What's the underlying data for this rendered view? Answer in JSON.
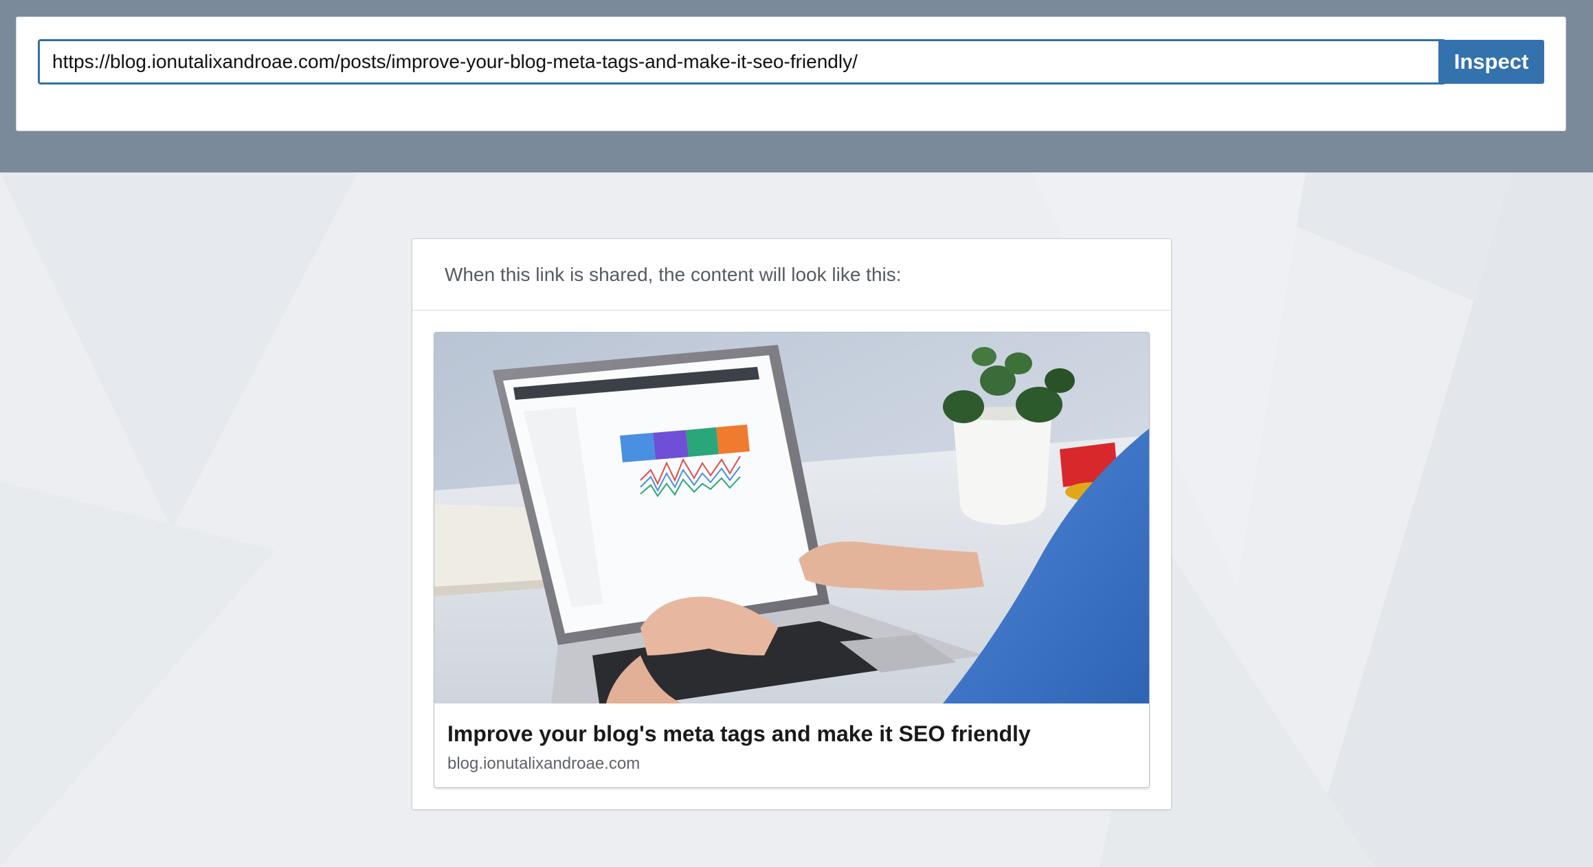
{
  "inspector": {
    "url_value": "https://blog.ionutalixandroae.com/posts/improve-your-blog-meta-tags-and-make-it-seo-friendly/",
    "inspect_label": "Inspect"
  },
  "preview": {
    "header_text": "When this link is shared, the content will look like this:",
    "card": {
      "title": "Improve your blog's meta tags and make it SEO friendly",
      "domain": "blog.ionutalixandroae.com",
      "image_alt": "laptop-with-google-search-console-image"
    }
  },
  "colors": {
    "top_band": "#7a8a9a",
    "accent": "#3472ad",
    "input_border": "#2f6fad",
    "page_bg": "#eceef1"
  }
}
